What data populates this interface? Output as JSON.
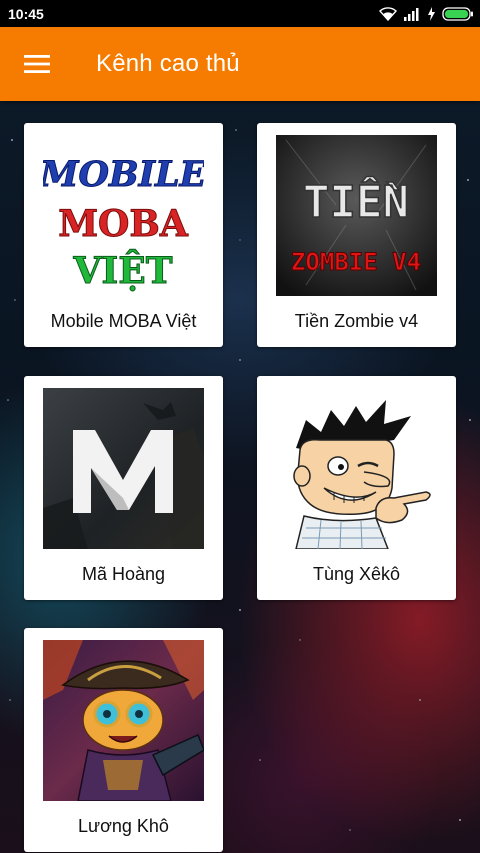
{
  "status_bar": {
    "time": "10:45",
    "icons": [
      "wifi-icon",
      "signal-icon",
      "charging-icon",
      "battery-icon"
    ]
  },
  "app_bar": {
    "title": "Kênh cao thủ",
    "menu_icon": "hamburger-menu-icon",
    "background_color": "#f57c00"
  },
  "channels": [
    {
      "name": "Mobile MOBA Việt",
      "thumbnail": "mobile-moba-viet-logo",
      "logo_text": [
        "MOBILE",
        "MOBA",
        "VIỆT"
      ]
    },
    {
      "name": "Tiền Zombie v4",
      "thumbnail": "tien-zombie-v4-logo",
      "logo_text": [
        "TIỀN",
        "ZOMBIE V4"
      ]
    },
    {
      "name": "Mã Hoàng",
      "thumbnail": "ma-hoang-m-logo"
    },
    {
      "name": "Tùng Xêkô",
      "thumbnail": "cartoon-character-pointing-avatar"
    },
    {
      "name": "Lương Khô",
      "thumbnail": "game-hero-artwork"
    }
  ]
}
